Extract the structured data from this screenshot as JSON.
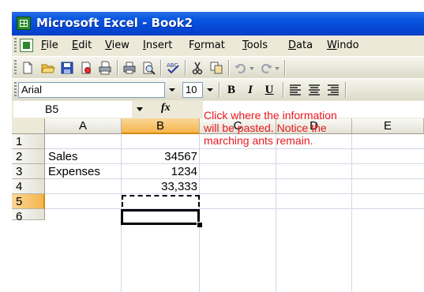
{
  "window": {
    "title": "Microsoft Excel - Book2",
    "app_icon": "excel-icon"
  },
  "menu": {
    "items": [
      {
        "u": "F",
        "rest": "ile"
      },
      {
        "u": "E",
        "rest": "dit"
      },
      {
        "u": "V",
        "rest": "iew"
      },
      {
        "u": "I",
        "rest": "nsert"
      },
      {
        "pre": "F",
        "u": "o",
        "rest": "rmat"
      },
      {
        "u": "T",
        "rest": "ools"
      },
      {
        "u": "D",
        "rest": "ata"
      },
      {
        "u": "W",
        "rest": "indo"
      }
    ]
  },
  "toolbar": {
    "icons": [
      "new-icon",
      "open-icon",
      "save-icon",
      "permission-icon",
      "print-area-icon",
      "print-icon",
      "print-preview-icon",
      "spelling-icon",
      "cut-icon",
      "copy-icon",
      "undo-icon",
      "redo-icon"
    ]
  },
  "format_toolbar": {
    "font": "Arial",
    "size": "10",
    "bold": "B",
    "italic": "I",
    "underline": "U",
    "align_icons": [
      "align-left-icon",
      "align-center-icon",
      "align-right-icon"
    ]
  },
  "formula_bar": {
    "name_box": "B5",
    "fx": "fx",
    "formula": ""
  },
  "grid": {
    "columns": [
      "A",
      "B",
      "C",
      "D",
      "E"
    ],
    "rows": [
      "1",
      "2",
      "3",
      "4",
      "5",
      "6"
    ],
    "selected_column": "B",
    "selected_row": "5",
    "cells": {
      "A2": "Sales",
      "B2": "34567",
      "A3": "Expenses",
      "B3": "1234",
      "B4": "33,333"
    }
  },
  "annotation": {
    "text": "Click where the information\nwill be pasted. Notice the\nmarching ants remain.",
    "color": "#e8191f"
  },
  "colors": {
    "title_bar": "#0a58e0",
    "selection_header": "#f5b54d",
    "chrome": "#ece9d8"
  }
}
